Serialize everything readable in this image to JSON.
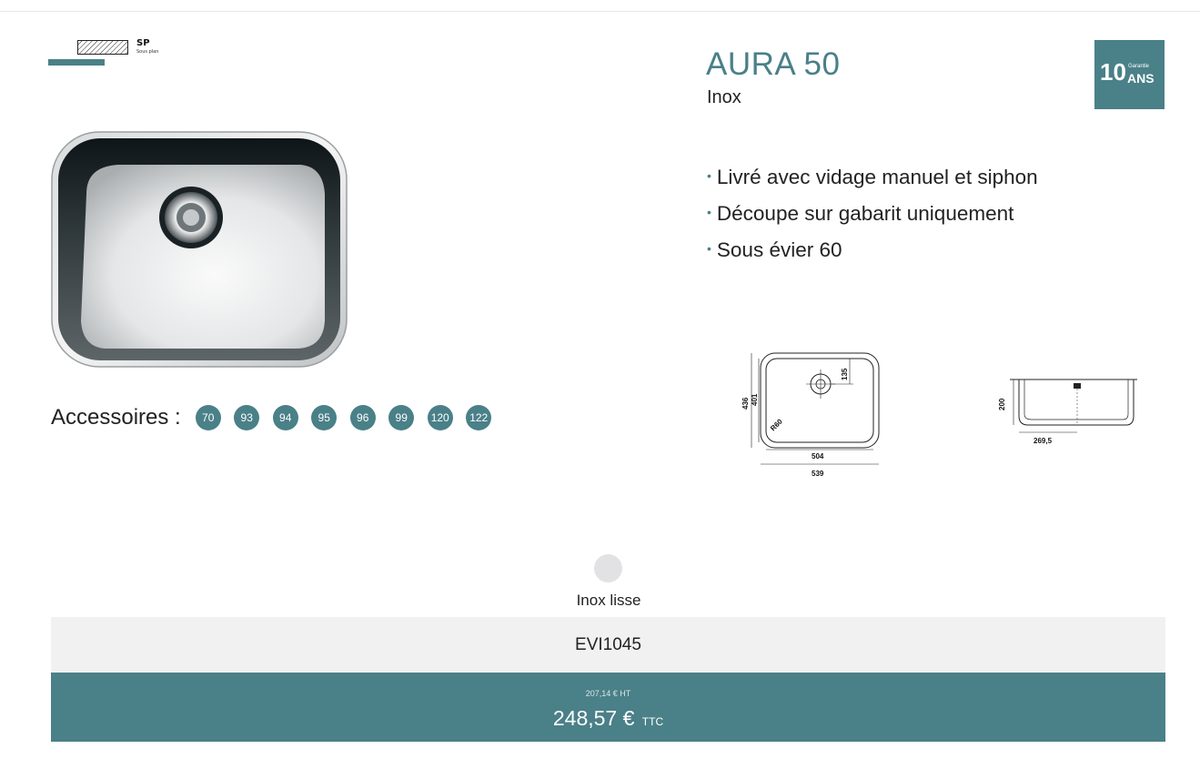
{
  "install_badge": {
    "code": "SP",
    "description": "Sous plan"
  },
  "product": {
    "name": "AURA 50",
    "material": "Inox"
  },
  "warranty": {
    "years": "10",
    "label_small": "Garantie",
    "label_big": "ANS"
  },
  "features": [
    "Livré avec vidage manuel et siphon",
    "Découpe sur gabarit uniquement",
    "Sous évier 60"
  ],
  "accessories": {
    "label": "Accessoires :",
    "numbers": [
      "70",
      "93",
      "94",
      "95",
      "96",
      "99",
      "120",
      "122"
    ]
  },
  "technical_drawing": {
    "top_view": {
      "width_outer": "539",
      "width_inner": "504",
      "depth_outer": "436",
      "depth_inner": "401",
      "drain_offset": "135",
      "radius": "R60"
    },
    "side_view": {
      "height": "200",
      "drain_position": "269,5"
    }
  },
  "finish": {
    "label": "Inox lisse",
    "swatch_color": "#e2e2e4"
  },
  "reference": {
    "code": "EVI1045"
  },
  "price": {
    "ht": "207,14 € HT",
    "ttc": "248,57 €",
    "ttc_unit": "TTC"
  },
  "colors": {
    "accent": "#4a8088",
    "band": "#f1f1f1"
  }
}
